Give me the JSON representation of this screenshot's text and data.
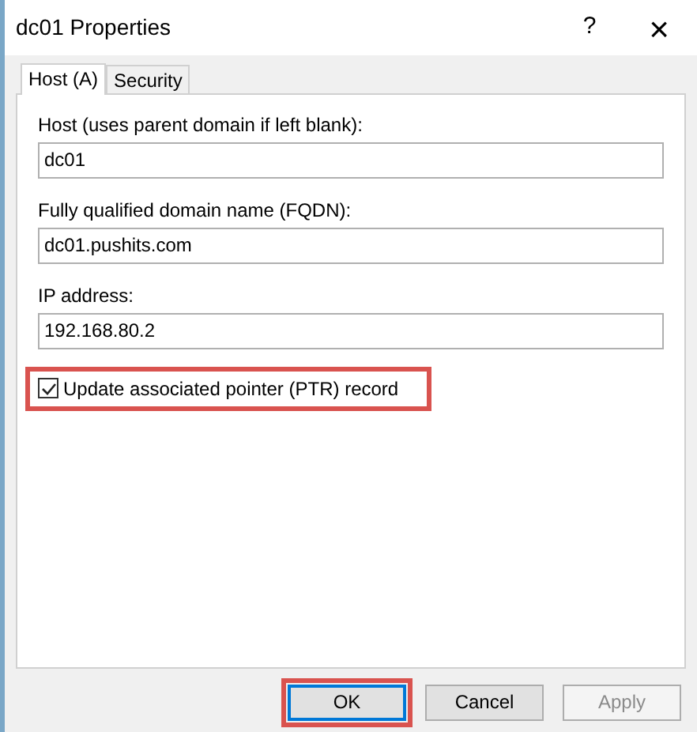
{
  "window": {
    "title": "dc01 Properties",
    "help": "?",
    "close": "×"
  },
  "tabs": [
    {
      "label": "Host (A)",
      "selected": true
    },
    {
      "label": "Security",
      "selected": false
    }
  ],
  "fields": [
    {
      "label": "Host (uses parent domain if left blank):",
      "value": "dc01"
    },
    {
      "label": "Fully qualified domain name (FQDN):",
      "value": "dc01.pushits.com"
    },
    {
      "label": "IP address:",
      "value": "192.168.80.2"
    }
  ],
  "checkbox": {
    "label": "Update associated pointer (PTR) record",
    "checked": true,
    "highlighted": true
  },
  "buttons": [
    {
      "label": "OK",
      "default": true,
      "disabled": false,
      "highlighted": true
    },
    {
      "label": "Cancel",
      "default": false,
      "disabled": false,
      "highlighted": false
    },
    {
      "label": "Apply",
      "default": false,
      "disabled": true,
      "highlighted": false
    }
  ]
}
